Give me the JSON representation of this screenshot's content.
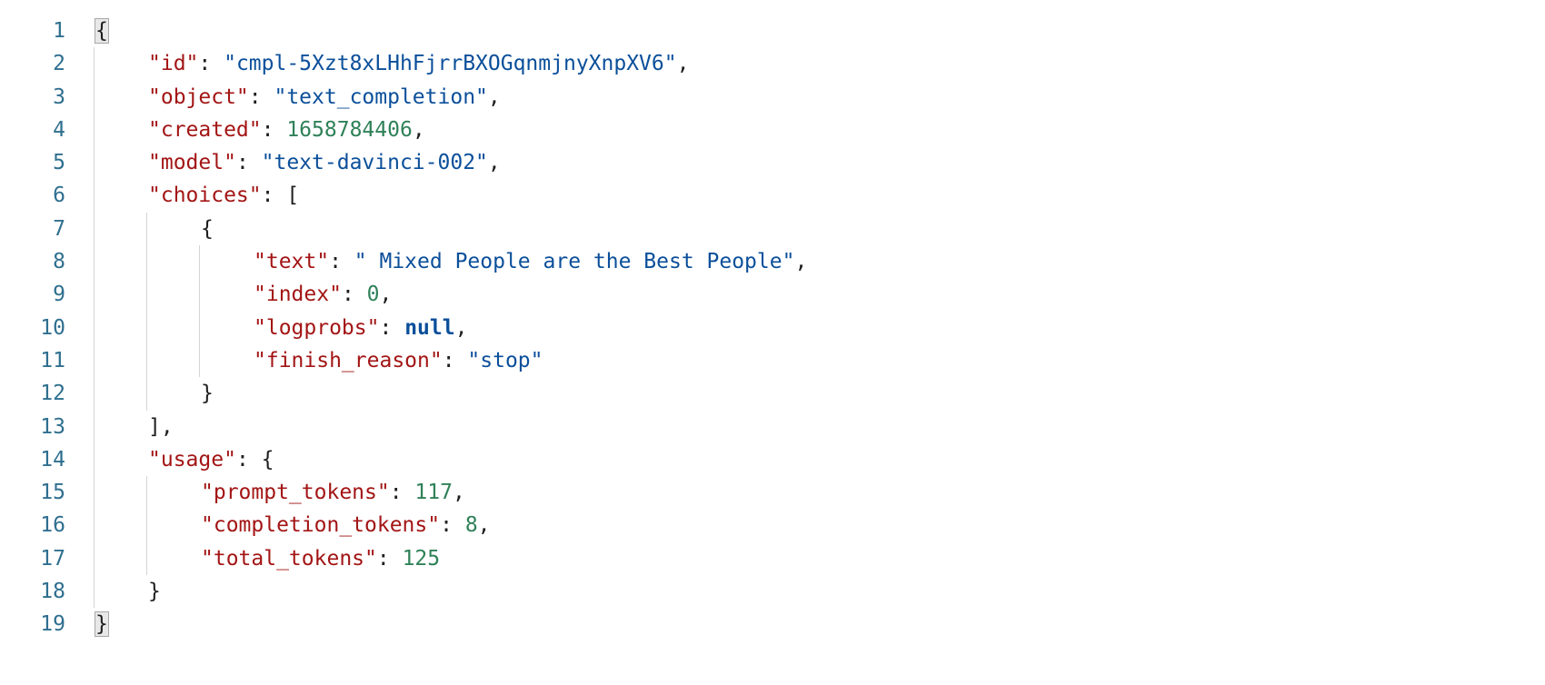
{
  "editor": {
    "lines": [
      {
        "n": "1",
        "indent": 0,
        "tokens": [
          {
            "t": "{",
            "c": "punc",
            "match": true
          }
        ]
      },
      {
        "n": "2",
        "indent": 1,
        "tokens": [
          {
            "t": "\"id\"",
            "c": "key"
          },
          {
            "t": ": ",
            "c": "punc"
          },
          {
            "t": "\"cmpl-5Xzt8xLHhFjrrBXOGqnmjnyXnpXV6\"",
            "c": "str"
          },
          {
            "t": ",",
            "c": "punc"
          }
        ]
      },
      {
        "n": "3",
        "indent": 1,
        "tokens": [
          {
            "t": "\"object\"",
            "c": "key"
          },
          {
            "t": ": ",
            "c": "punc"
          },
          {
            "t": "\"text_completion\"",
            "c": "str"
          },
          {
            "t": ",",
            "c": "punc"
          }
        ]
      },
      {
        "n": "4",
        "indent": 1,
        "tokens": [
          {
            "t": "\"created\"",
            "c": "key"
          },
          {
            "t": ": ",
            "c": "punc"
          },
          {
            "t": "1658784406",
            "c": "num"
          },
          {
            "t": ",",
            "c": "punc"
          }
        ]
      },
      {
        "n": "5",
        "indent": 1,
        "tokens": [
          {
            "t": "\"model\"",
            "c": "key"
          },
          {
            "t": ": ",
            "c": "punc"
          },
          {
            "t": "\"text-davinci-002\"",
            "c": "str"
          },
          {
            "t": ",",
            "c": "punc"
          }
        ]
      },
      {
        "n": "6",
        "indent": 1,
        "tokens": [
          {
            "t": "\"choices\"",
            "c": "key"
          },
          {
            "t": ": [",
            "c": "punc"
          }
        ]
      },
      {
        "n": "7",
        "indent": 2,
        "tokens": [
          {
            "t": "{",
            "c": "punc"
          }
        ]
      },
      {
        "n": "8",
        "indent": 3,
        "tokens": [
          {
            "t": "\"text\"",
            "c": "key"
          },
          {
            "t": ": ",
            "c": "punc"
          },
          {
            "t": "\" Mixed People are the Best People\"",
            "c": "str"
          },
          {
            "t": ",",
            "c": "punc"
          }
        ]
      },
      {
        "n": "9",
        "indent": 3,
        "tokens": [
          {
            "t": "\"index\"",
            "c": "key"
          },
          {
            "t": ": ",
            "c": "punc"
          },
          {
            "t": "0",
            "c": "num"
          },
          {
            "t": ",",
            "c": "punc"
          }
        ]
      },
      {
        "n": "10",
        "indent": 3,
        "tokens": [
          {
            "t": "\"logprobs\"",
            "c": "key"
          },
          {
            "t": ": ",
            "c": "punc"
          },
          {
            "t": "null",
            "c": "kw"
          },
          {
            "t": ",",
            "c": "punc"
          }
        ]
      },
      {
        "n": "11",
        "indent": 3,
        "tokens": [
          {
            "t": "\"finish_reason\"",
            "c": "key"
          },
          {
            "t": ": ",
            "c": "punc"
          },
          {
            "t": "\"stop\"",
            "c": "str"
          }
        ]
      },
      {
        "n": "12",
        "indent": 2,
        "tokens": [
          {
            "t": "}",
            "c": "punc"
          }
        ]
      },
      {
        "n": "13",
        "indent": 1,
        "tokens": [
          {
            "t": "],",
            "c": "punc"
          }
        ]
      },
      {
        "n": "14",
        "indent": 1,
        "tokens": [
          {
            "t": "\"usage\"",
            "c": "key"
          },
          {
            "t": ": {",
            "c": "punc"
          }
        ]
      },
      {
        "n": "15",
        "indent": 2,
        "tokens": [
          {
            "t": "\"prompt_tokens\"",
            "c": "key"
          },
          {
            "t": ": ",
            "c": "punc"
          },
          {
            "t": "117",
            "c": "num"
          },
          {
            "t": ",",
            "c": "punc"
          }
        ]
      },
      {
        "n": "16",
        "indent": 2,
        "tokens": [
          {
            "t": "\"completion_tokens\"",
            "c": "key"
          },
          {
            "t": ": ",
            "c": "punc"
          },
          {
            "t": "8",
            "c": "num"
          },
          {
            "t": ",",
            "c": "punc"
          }
        ]
      },
      {
        "n": "17",
        "indent": 2,
        "tokens": [
          {
            "t": "\"total_tokens\"",
            "c": "key"
          },
          {
            "t": ": ",
            "c": "punc"
          },
          {
            "t": "125",
            "c": "num"
          }
        ]
      },
      {
        "n": "18",
        "indent": 1,
        "tokens": [
          {
            "t": "}",
            "c": "punc"
          }
        ]
      },
      {
        "n": "19",
        "indent": 0,
        "tokens": [
          {
            "t": "}",
            "c": "punc",
            "match": true
          }
        ]
      }
    ]
  },
  "colors": {
    "key": "#a31515",
    "string": "#0b4f9a",
    "number": "#2f8158",
    "keyword": "#0b4f9a",
    "line_number": "#2f6f8f",
    "indent_guide": "#d4d4d4"
  }
}
